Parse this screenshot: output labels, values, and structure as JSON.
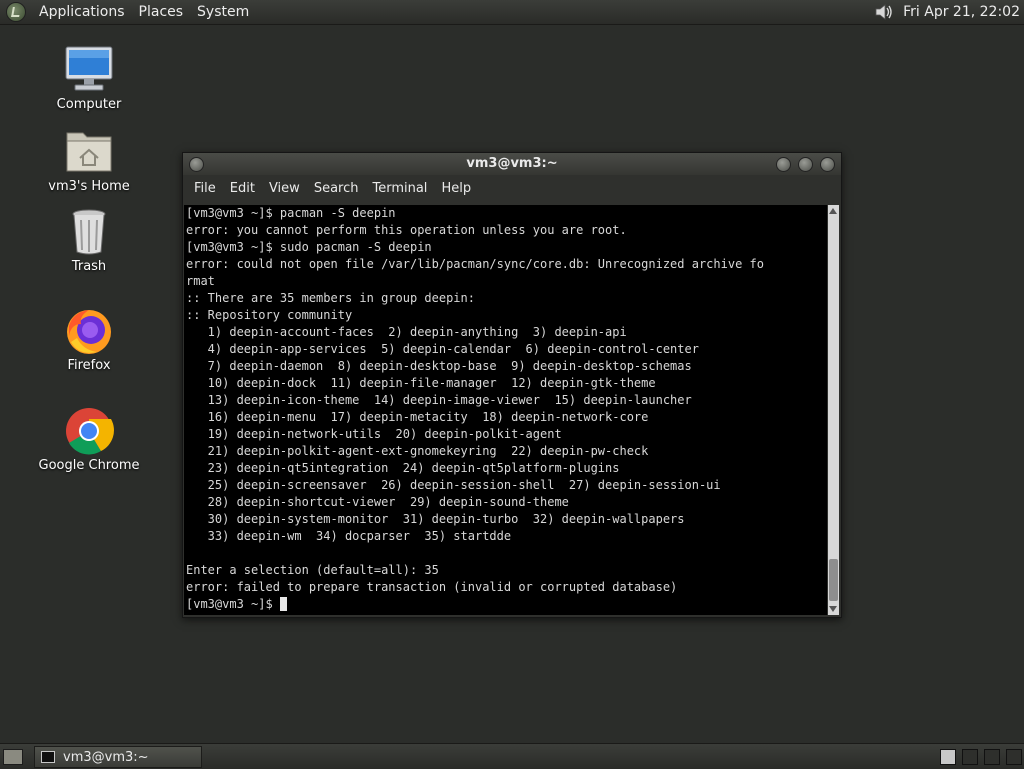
{
  "top_panel": {
    "menus": [
      "Applications",
      "Places",
      "System"
    ],
    "clock": "Fri Apr 21, 22:02"
  },
  "desktop": {
    "icons": [
      {
        "label": "Computer",
        "icon": "computer-icon"
      },
      {
        "label": "vm3's Home",
        "icon": "home-folder-icon"
      },
      {
        "label": "Trash",
        "icon": "trash-icon"
      },
      {
        "label": "Firefox",
        "icon": "firefox-icon"
      },
      {
        "label": "Google Chrome",
        "icon": "chrome-icon"
      }
    ]
  },
  "terminal": {
    "title": "vm3@vm3:~",
    "menu": [
      "File",
      "Edit",
      "View",
      "Search",
      "Terminal",
      "Help"
    ],
    "lines": [
      "[vm3@vm3 ~]$ pacman -S deepin",
      "error: you cannot perform this operation unless you are root.",
      "[vm3@vm3 ~]$ sudo pacman -S deepin",
      "error: could not open file /var/lib/pacman/sync/core.db: Unrecognized archive fo",
      "rmat",
      ":: There are 35 members in group deepin:",
      ":: Repository community",
      "   1) deepin-account-faces  2) deepin-anything  3) deepin-api",
      "   4) deepin-app-services  5) deepin-calendar  6) deepin-control-center",
      "   7) deepin-daemon  8) deepin-desktop-base  9) deepin-desktop-schemas",
      "   10) deepin-dock  11) deepin-file-manager  12) deepin-gtk-theme",
      "   13) deepin-icon-theme  14) deepin-image-viewer  15) deepin-launcher",
      "   16) deepin-menu  17) deepin-metacity  18) deepin-network-core",
      "   19) deepin-network-utils  20) deepin-polkit-agent",
      "   21) deepin-polkit-agent-ext-gnomekeyring  22) deepin-pw-check",
      "   23) deepin-qt5integration  24) deepin-qt5platform-plugins",
      "   25) deepin-screensaver  26) deepin-session-shell  27) deepin-session-ui",
      "   28) deepin-shortcut-viewer  29) deepin-sound-theme",
      "   30) deepin-system-monitor  31) deepin-turbo  32) deepin-wallpapers",
      "   33) deepin-wm  34) docparser  35) startdde",
      "",
      "Enter a selection (default=all): 35",
      "error: failed to prepare transaction (invalid or corrupted database)"
    ],
    "prompt": "[vm3@vm3 ~]$ "
  },
  "taskbar": {
    "task_label": "vm3@vm3:~"
  }
}
